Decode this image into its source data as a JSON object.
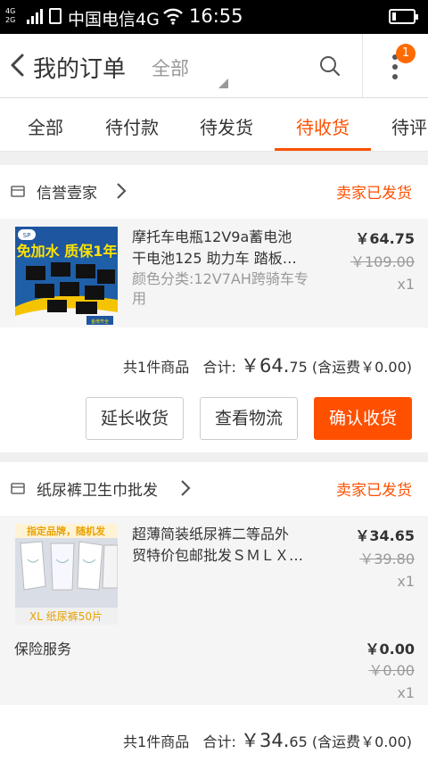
{
  "status_bar": {
    "network_top": "4G",
    "network_bottom": "2G",
    "carrier": "中国电信4G",
    "time": "16:55",
    "battery_level": 0.2
  },
  "header": {
    "back_icon": "chevron-left-icon",
    "title": "我的订单",
    "filter": "全部",
    "search_icon": "search-icon",
    "more_icon": "more-vertical-icon",
    "badge": "1"
  },
  "tabs": [
    "全部",
    "待付款",
    "待发货",
    "待收货",
    "待评"
  ],
  "active_tab": "待收货",
  "orders": [
    {
      "shop": "信誉壹家",
      "status": "卖家已发货",
      "item": {
        "name_line1": "摩托车电瓶12V9a蓄电池",
        "name_line2": "干电池125 助力车 踏板…",
        "sku": "颜色分类:12V7AH跨骑车专用",
        "price": "￥64.75",
        "original_price": "￥109.00",
        "qty": "x1",
        "thumb_text": "免加水 质保1年",
        "thumb_logo": "SP",
        "thumb_brand": "金增齐全"
      },
      "summary": {
        "count": "共1件商品",
        "total_label": "合计:",
        "total_big": "￥64.",
        "total_small": "75",
        "shipping": "(含运费￥0.00)"
      },
      "buttons": [
        "延长收货",
        "查看物流",
        "确认收货"
      ]
    },
    {
      "shop": "纸尿裤卫生巾批发",
      "status": "卖家已发货",
      "item": {
        "name_line1": "超薄简装纸尿裤二等品外",
        "name_line2": "贸特价包邮批发ＳＭＬＸ…",
        "price": "￥34.65",
        "original_price": "￥39.80",
        "qty": "x1",
        "thumb_top": "指定品牌，随机发",
        "thumb_bottom": "XL 纸尿裤50片"
      },
      "insurance": {
        "label": "保险服务",
        "price": "￥0.00",
        "original_price": "￥0.00",
        "qty": "x1"
      },
      "summary": {
        "count": "共1件商品",
        "total_label": "合计:",
        "total_big": "￥34.",
        "total_small": "65",
        "shipping": "(含运费￥0.00)"
      }
    }
  ],
  "colors": {
    "accent": "#ff5000",
    "badge": "#ff6a00",
    "muted": "#999999"
  }
}
